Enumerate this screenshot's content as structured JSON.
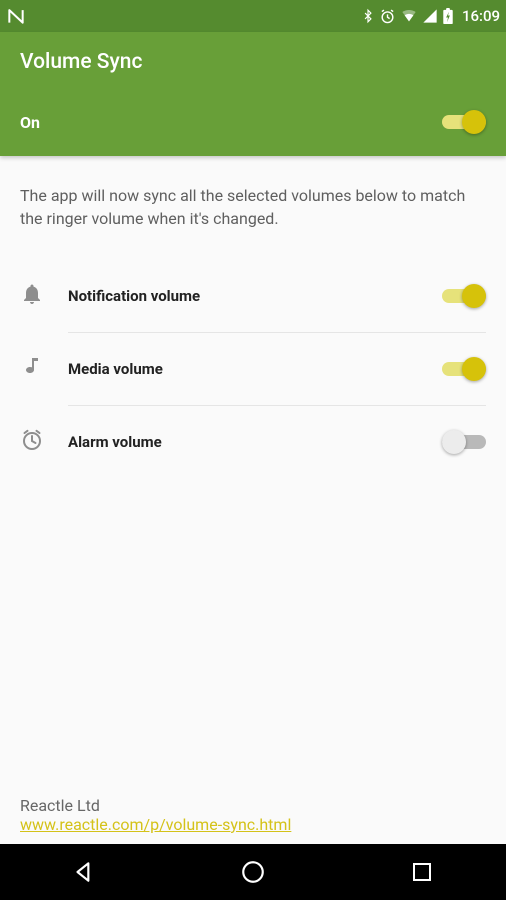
{
  "status": {
    "clock": "16:09"
  },
  "app": {
    "title": "Volume Sync"
  },
  "master": {
    "label": "On",
    "on": true
  },
  "description": "The app will now sync all the selected volumes below to match the ringer volume when it's changed.",
  "settings": [
    {
      "icon": "bell",
      "label": "Notification volume",
      "on": true
    },
    {
      "icon": "note",
      "label": "Media volume",
      "on": true
    },
    {
      "icon": "alarm",
      "label": "Alarm volume",
      "on": false
    }
  ],
  "footer": {
    "company": "Reactle Ltd",
    "link_text": "www.reactle.com/p/volume-sync.html"
  }
}
